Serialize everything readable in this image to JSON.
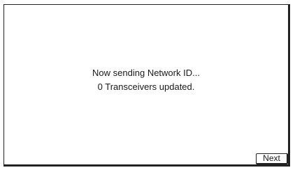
{
  "dialog": {
    "status_line": "Now sending Network ID...",
    "progress_line": "0 Transceivers updated.",
    "next_label": "Next"
  },
  "colors": {
    "border": "#222222",
    "background": "#ffffff",
    "text": "#1a1a1a"
  }
}
